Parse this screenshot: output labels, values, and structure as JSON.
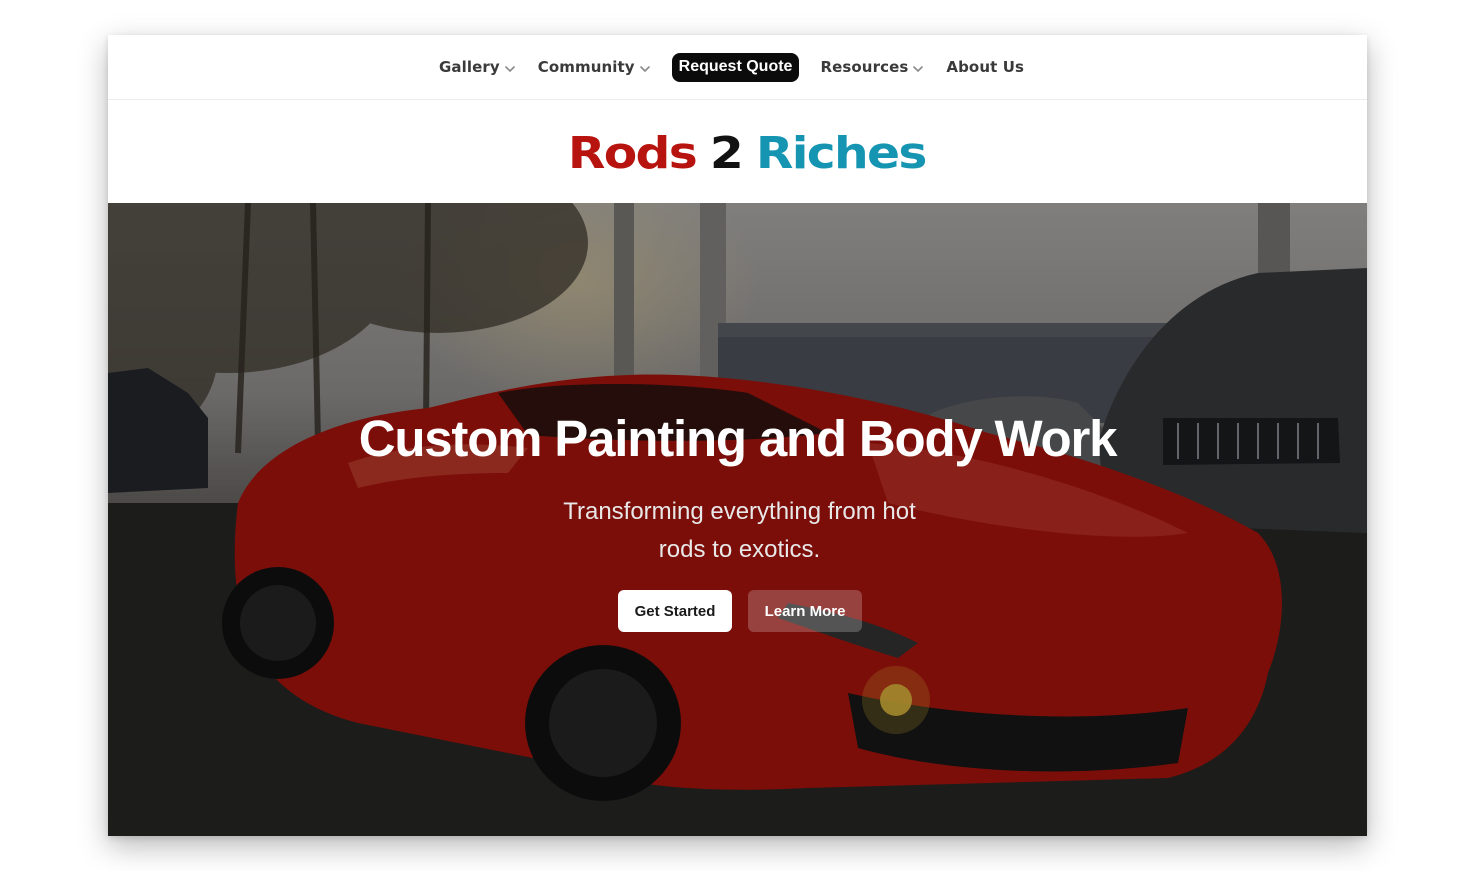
{
  "nav": {
    "items": [
      {
        "label": "Gallery",
        "has_dropdown": true
      },
      {
        "label": "Community",
        "has_dropdown": true
      },
      {
        "label": "Request Quote",
        "highlight": true
      },
      {
        "label": "Resources",
        "has_dropdown": true
      },
      {
        "label": "About Us",
        "has_dropdown": false
      }
    ]
  },
  "logo": {
    "word1": "Rods",
    "word2": "2",
    "word3": "Riches",
    "colors": {
      "word1": "#b8140f",
      "word2": "#121212",
      "word3": "#1595b2"
    }
  },
  "hero": {
    "title": "Custom Painting and Body Work",
    "subtitle": "Transforming everything from hot rods to exotics.",
    "primary_button": "Get Started",
    "secondary_button": "Learn More"
  },
  "icons": {
    "dropdown": "chevron-down-icon"
  }
}
